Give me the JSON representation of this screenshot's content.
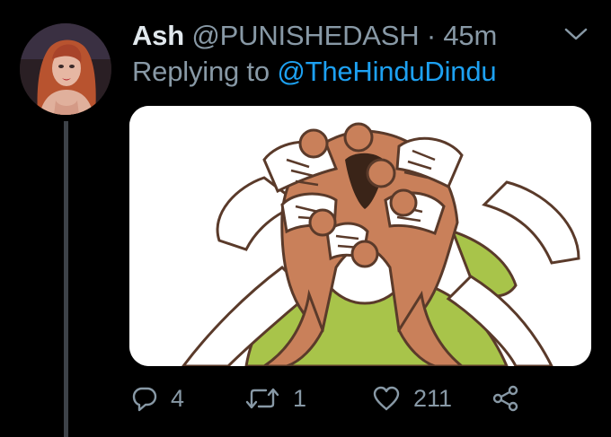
{
  "tweet": {
    "display_name": "Ash",
    "handle": "@PUNISHEDASH",
    "separator": "·",
    "time": "45m",
    "replying_prefix": "Replying to",
    "replying_to": "@TheHinduDindu",
    "media_alt": ""
  },
  "actions": {
    "reply_count": "4",
    "retweet_count": "1",
    "like_count": "211"
  },
  "icons": {
    "menu": "chevron-down-icon",
    "reply": "reply-icon",
    "retweet": "retweet-icon",
    "like": "heart-icon",
    "share": "share-icon"
  },
  "colors": {
    "background": "#000000",
    "name": "#e1e8ed",
    "secondary": "#8899a6",
    "link": "#1da1f2",
    "thread_line": "#3d4248"
  }
}
